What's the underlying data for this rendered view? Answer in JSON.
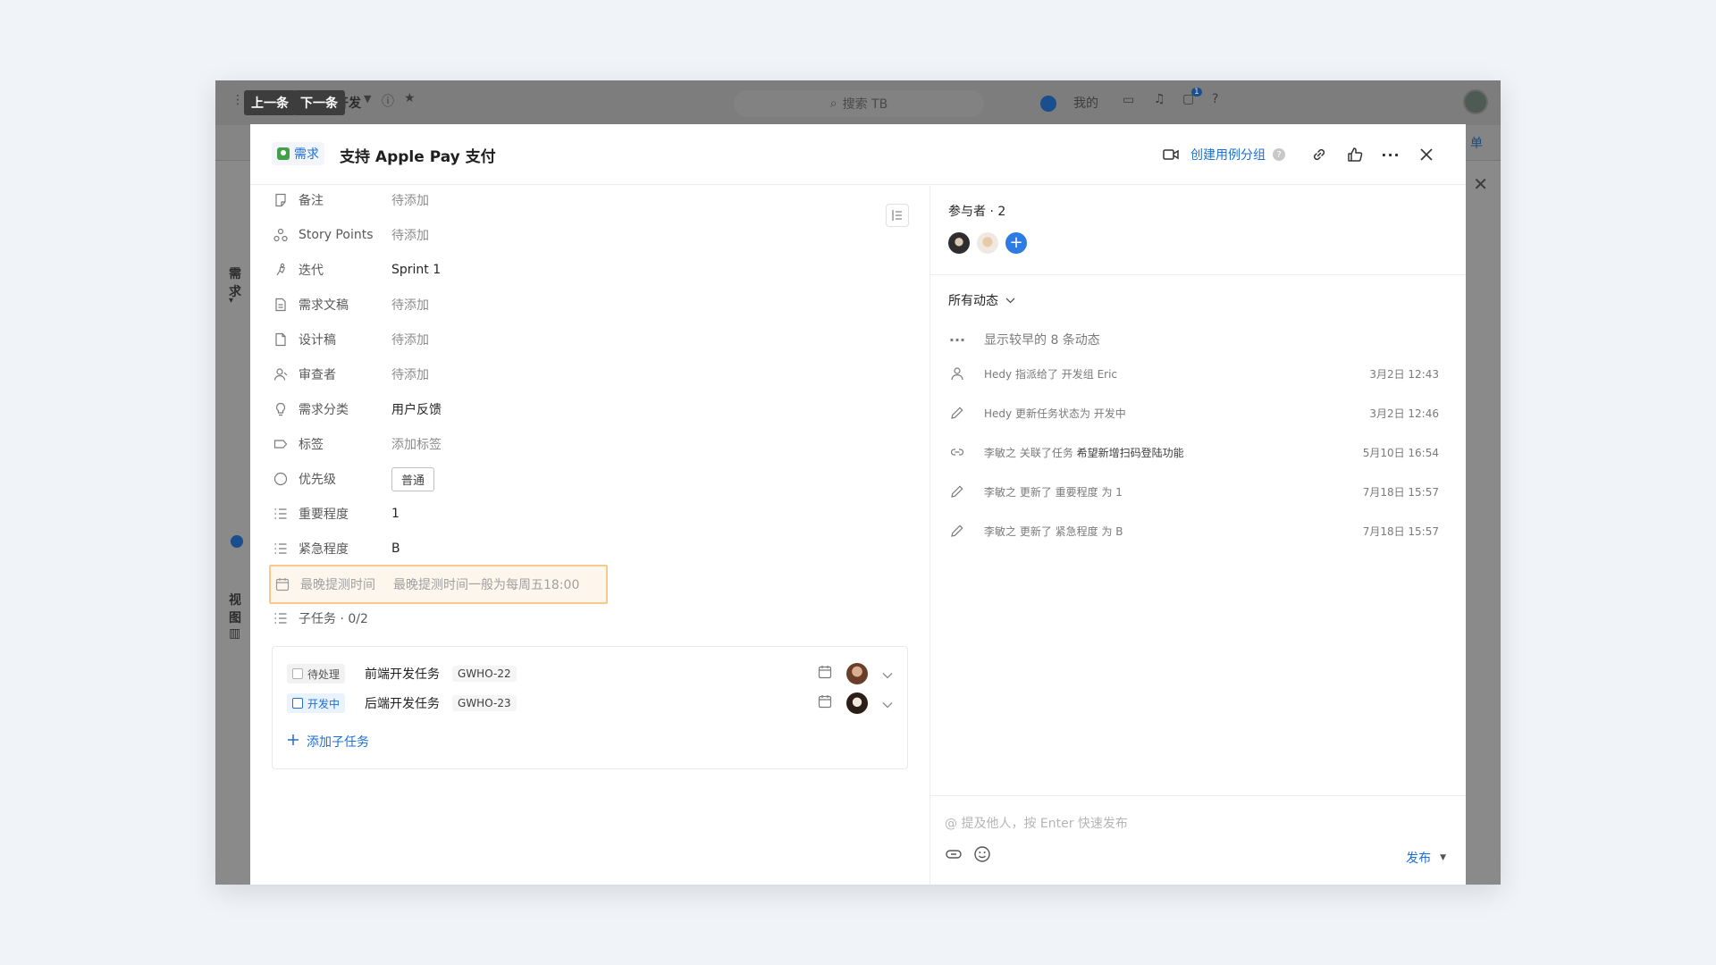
{
  "background_app": {
    "nav_prev": "上一条",
    "nav_next": "下一条",
    "project_name_fragment": "开发",
    "search_placeholder": "搜索 TB",
    "mine_label": "我的",
    "left_label_1": "需求",
    "left_label_2": "视图",
    "right_link_fragment": "单",
    "notification_count": "1"
  },
  "modal": {
    "type_tag": "需求",
    "title": "支持 Apple Pay 支付",
    "create_link": "创建用例分组",
    "help": "?"
  },
  "fields": [
    {
      "label": "备注",
      "value": "待添加",
      "icon": "note-icon"
    },
    {
      "label": "Story Points",
      "value": "待添加",
      "icon": "story-points-icon"
    },
    {
      "label": "迭代",
      "value": "Sprint 1",
      "icon": "sprint-icon"
    },
    {
      "label": "需求文稿",
      "value": "待添加",
      "icon": "document-icon"
    },
    {
      "label": "设计稿",
      "value": "待添加",
      "icon": "file-icon"
    },
    {
      "label": "审查者",
      "value": "待添加",
      "icon": "reviewer-icon"
    },
    {
      "label": "需求分类",
      "value": "用户反馈",
      "icon": "bulb-icon"
    },
    {
      "label": "标签",
      "value": "添加标签",
      "icon": "tag-icon"
    },
    {
      "label": "优先级",
      "value": "普通",
      "icon": "priority-icon"
    },
    {
      "label": "重要程度",
      "value": "1",
      "icon": "list-icon"
    },
    {
      "label": "紧急程度",
      "value": "B",
      "icon": "list-icon"
    },
    {
      "label": "最晚提测时间",
      "value": "最晚提测时间一般为每周五18:00",
      "icon": "calendar-icon"
    },
    {
      "label": "子任务 · 0/2",
      "value": "",
      "icon": "list-icon"
    }
  ],
  "subtasks": [
    {
      "status": "待处理",
      "name": "前端开发任务",
      "code": "GWHO-22"
    },
    {
      "status": "开发中",
      "name": "后端开发任务",
      "code": "GWHO-23"
    }
  ],
  "add_subtask": "添加子任务",
  "participants": {
    "title": "参与者 · 2"
  },
  "activity": {
    "filter": "所有动态",
    "show_more": "显示较早的 8 条动态",
    "items": [
      {
        "text": "Hedy 指派给了 开发组 Eric",
        "time": "3月2日 12:43"
      },
      {
        "text": "Hedy 更新任务状态为 开发中",
        "time": "3月2日 12:46"
      },
      {
        "text": "李敏之 关联了任务 ",
        "link": "希望新增扫码登陆功能",
        "time": "5月10日 16:54"
      },
      {
        "text": "李敏之 更新了 重要程度 为 1",
        "time": "7月18日 15:57"
      },
      {
        "text": "李敏之 更新了 紧急程度 为 B",
        "time": "7月18日 15:57"
      }
    ]
  },
  "comment": {
    "placeholder": "@ 提及他人，按 Enter 快速发布",
    "publish": "发布"
  }
}
